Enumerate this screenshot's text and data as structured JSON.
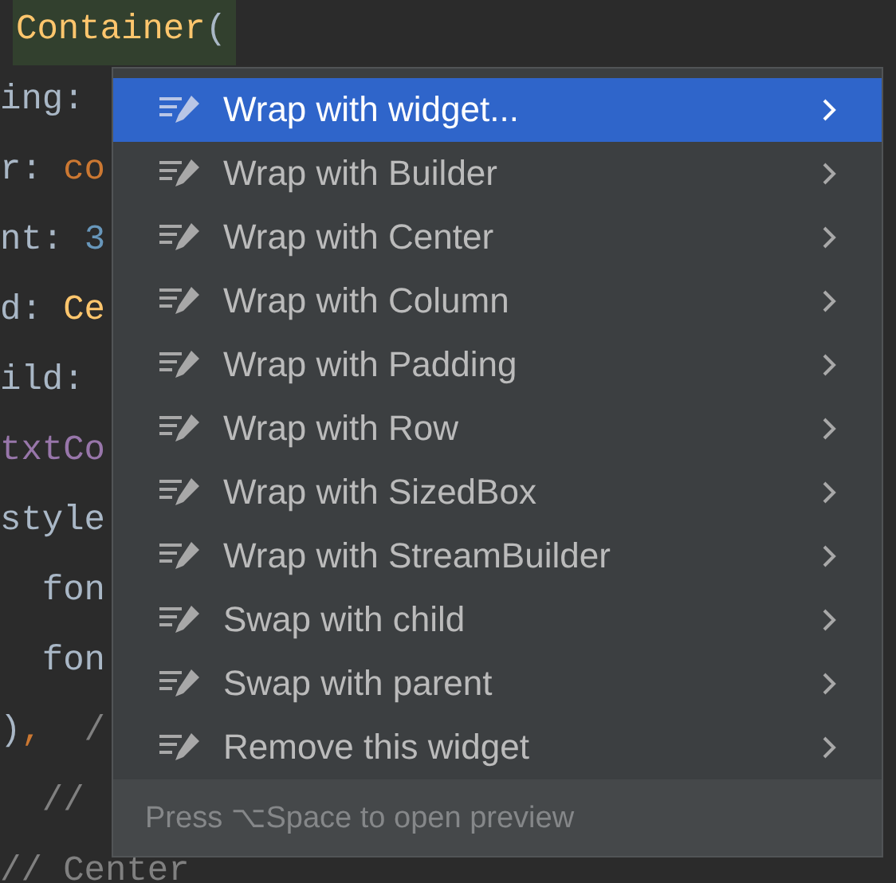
{
  "editor": {
    "lines": [
      {
        "highlighted": true,
        "tokens": [
          {
            "text": "Container",
            "kind": "class"
          },
          {
            "text": "(",
            "kind": "paren"
          }
        ]
      },
      {
        "highlighted": false,
        "tokens": [
          {
            "text": "ing:",
            "kind": "plain"
          }
        ]
      },
      {
        "highlighted": false,
        "tokens": [
          {
            "text": "r: ",
            "kind": "plain"
          },
          {
            "text": "co",
            "kind": "keyword"
          }
        ]
      },
      {
        "highlighted": false,
        "tokens": [
          {
            "text": "nt: ",
            "kind": "plain"
          },
          {
            "text": "3",
            "kind": "number"
          }
        ]
      },
      {
        "highlighted": false,
        "tokens": [
          {
            "text": "d: ",
            "kind": "plain"
          },
          {
            "text": "Ce",
            "kind": "class"
          }
        ]
      },
      {
        "highlighted": false,
        "tokens": [
          {
            "text": "ild:",
            "kind": "plain"
          }
        ]
      },
      {
        "highlighted": false,
        "tokens": [
          {
            "text": "txtCo",
            "kind": "field"
          }
        ]
      },
      {
        "highlighted": false,
        "tokens": [
          {
            "text": "style",
            "kind": "plain"
          }
        ]
      },
      {
        "highlighted": false,
        "tokens": [
          {
            "text": "  fon",
            "kind": "plain"
          }
        ]
      },
      {
        "highlighted": false,
        "tokens": [
          {
            "text": "  fon",
            "kind": "plain"
          }
        ]
      },
      {
        "highlighted": false,
        "tokens": [
          {
            "text": ")",
            "kind": "plain"
          },
          {
            "text": ",",
            "kind": "keyword"
          },
          {
            "text": "  /",
            "kind": "comment"
          }
        ]
      },
      {
        "highlighted": false,
        "tokens": [
          {
            "text": "  //",
            "kind": "comment"
          }
        ]
      },
      {
        "highlighted": false,
        "tokens": [
          {
            "text": "// Center",
            "kind": "comment"
          }
        ]
      }
    ]
  },
  "popup": {
    "items": [
      {
        "label": "Wrap with widget...",
        "selected": true,
        "submenu": true
      },
      {
        "label": "Wrap with Builder",
        "selected": false,
        "submenu": true
      },
      {
        "label": "Wrap with Center",
        "selected": false,
        "submenu": true
      },
      {
        "label": "Wrap with Column",
        "selected": false,
        "submenu": true
      },
      {
        "label": "Wrap with Padding",
        "selected": false,
        "submenu": true
      },
      {
        "label": "Wrap with Row",
        "selected": false,
        "submenu": true
      },
      {
        "label": "Wrap with SizedBox",
        "selected": false,
        "submenu": true
      },
      {
        "label": "Wrap with StreamBuilder",
        "selected": false,
        "submenu": true
      },
      {
        "label": "Swap with child",
        "selected": false,
        "submenu": true
      },
      {
        "label": "Swap with parent",
        "selected": false,
        "submenu": true
      },
      {
        "label": "Remove this widget",
        "selected": false,
        "submenu": true
      }
    ],
    "footer": "Press ⌥Space to open preview"
  }
}
